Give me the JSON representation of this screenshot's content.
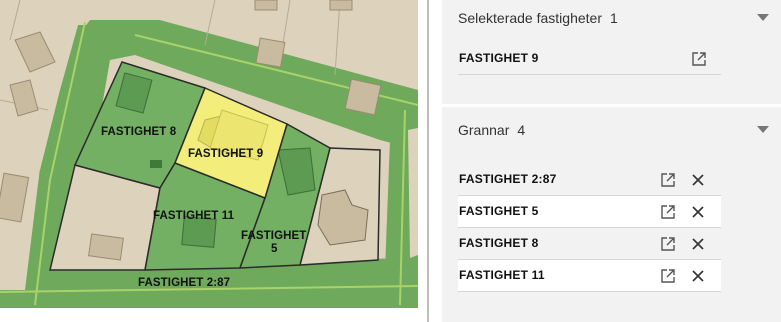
{
  "map": {
    "labels": {
      "fastighet_8": "FASTIGHET 8",
      "fastighet_9": "FASTIGHET 9",
      "fastighet_11": "FASTIGHET 11",
      "fastighet_5_line1": "FASTIGHET",
      "fastighet_5_line2": "5",
      "fastighet_2_87": "FASTIGHET 2:87"
    },
    "colors": {
      "background": "#ddd3bd",
      "road": "#6ea95c",
      "neighbour_parcel": "#74b063",
      "selected_parcel": "#f3ee7c",
      "building": "#c9bba0",
      "boundary": "#2b2b2b"
    }
  },
  "selected": {
    "title": "Selekterade fastigheter",
    "count": "1",
    "items": [
      {
        "label": "FASTIGHET 9",
        "icon": "open-external-icon"
      }
    ]
  },
  "neighbours": {
    "title": "Grannar",
    "count": "4",
    "items": [
      {
        "label": "FASTIGHET 2:87",
        "icons": [
          "open-external-icon",
          "close-icon"
        ]
      },
      {
        "label": "FASTIGHET 5",
        "icons": [
          "open-external-icon",
          "close-icon"
        ]
      },
      {
        "label": "FASTIGHET 8",
        "icons": [
          "open-external-icon",
          "close-icon"
        ]
      },
      {
        "label": "FASTIGHET 11",
        "icons": [
          "open-external-icon",
          "close-icon"
        ]
      }
    ]
  }
}
